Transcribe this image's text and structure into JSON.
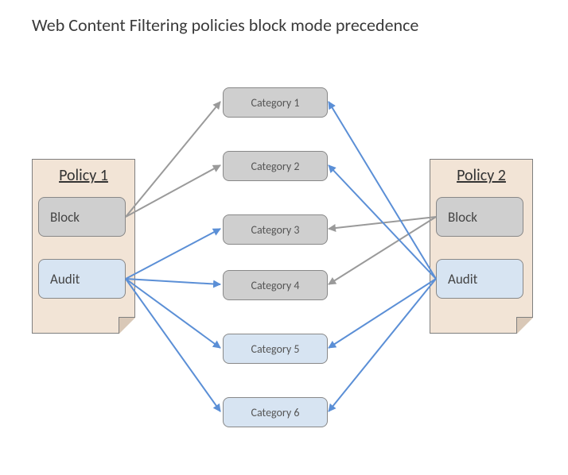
{
  "title": "Web Content Filtering policies block mode precedence",
  "policy1": {
    "title": "Policy 1",
    "block_label": "Block",
    "audit_label": "Audit"
  },
  "policy2": {
    "title": "Policy 2",
    "block_label": "Block",
    "audit_label": "Audit"
  },
  "categories": [
    {
      "label": "Category  1",
      "color": "gray"
    },
    {
      "label": "Category  2",
      "color": "gray"
    },
    {
      "label": "Category  3",
      "color": "gray"
    },
    {
      "label": "Category  4",
      "color": "gray"
    },
    {
      "label": "Category  5",
      "color": "blue"
    },
    {
      "label": "Category  6",
      "color": "blue"
    }
  ],
  "arrows": [
    {
      "from": "p1-block",
      "to": 0,
      "color": "gray"
    },
    {
      "from": "p1-block",
      "to": 1,
      "color": "gray"
    },
    {
      "from": "p1-audit",
      "to": 2,
      "color": "blue"
    },
    {
      "from": "p1-audit",
      "to": 3,
      "color": "blue"
    },
    {
      "from": "p1-audit",
      "to": 4,
      "color": "blue"
    },
    {
      "from": "p1-audit",
      "to": 5,
      "color": "blue"
    },
    {
      "from": "p2-block",
      "to": 2,
      "color": "gray"
    },
    {
      "from": "p2-block",
      "to": 3,
      "color": "gray"
    },
    {
      "from": "p2-audit",
      "to": 0,
      "color": "blue"
    },
    {
      "from": "p2-audit",
      "to": 1,
      "color": "blue"
    },
    {
      "from": "p2-audit",
      "to": 4,
      "color": "blue"
    },
    {
      "from": "p2-audit",
      "to": 5,
      "color": "blue"
    }
  ],
  "colors": {
    "gray_arrow": "#9a9a9a",
    "blue_arrow": "#5b8fd6"
  }
}
